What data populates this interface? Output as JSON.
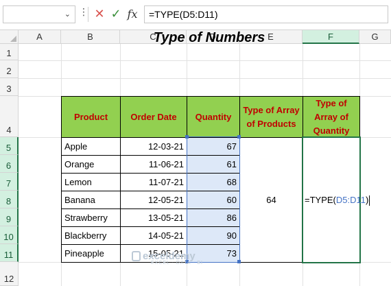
{
  "formula_bar": {
    "name_box_value": "",
    "cancel_icon": "cancel-x-icon",
    "enter_icon": "check-icon",
    "fx_label": "fx",
    "formula": "=TYPE(D5:D11)"
  },
  "columns": [
    "A",
    "B",
    "C",
    "D",
    "E",
    "F",
    "G"
  ],
  "rows": [
    "1",
    "2",
    "3",
    "4",
    "5",
    "6",
    "7",
    "8",
    "9",
    "10",
    "11",
    "12"
  ],
  "sheet": {
    "title": "Type of Numbers",
    "headers": {
      "product": "Product",
      "order_date": "Order Date",
      "quantity": "Quantity",
      "type_products": "Type of Array of Products",
      "type_quantity": "Type of Array of Quantity"
    },
    "data": [
      {
        "product": "Apple",
        "date": "12-03-21",
        "qty": "67"
      },
      {
        "product": "Orange",
        "date": "11-06-21",
        "qty": "61"
      },
      {
        "product": "Lemon",
        "date": "11-07-21",
        "qty": "68"
      },
      {
        "product": "Banana",
        "date": "12-05-21",
        "qty": "60"
      },
      {
        "product": "Strawberry",
        "date": "13-05-21",
        "qty": "86"
      },
      {
        "product": "Blackberry",
        "date": "14-05-21",
        "qty": "90"
      },
      {
        "product": "Pineapple",
        "date": "15-05-21",
        "qty": "73"
      }
    ],
    "type_products_value": "64",
    "edit_formula_prefix": "=TYPE(",
    "edit_formula_ref": "D5:D11",
    "edit_formula_suffix": ")"
  },
  "watermark": {
    "name": "exceldemy",
    "tagline": "EXCEL · DATA · BI"
  },
  "colors": {
    "header_fill": "#92d050",
    "header_text": "#c00000",
    "ref_blue": "#4472c4",
    "active_green": "#217346"
  }
}
